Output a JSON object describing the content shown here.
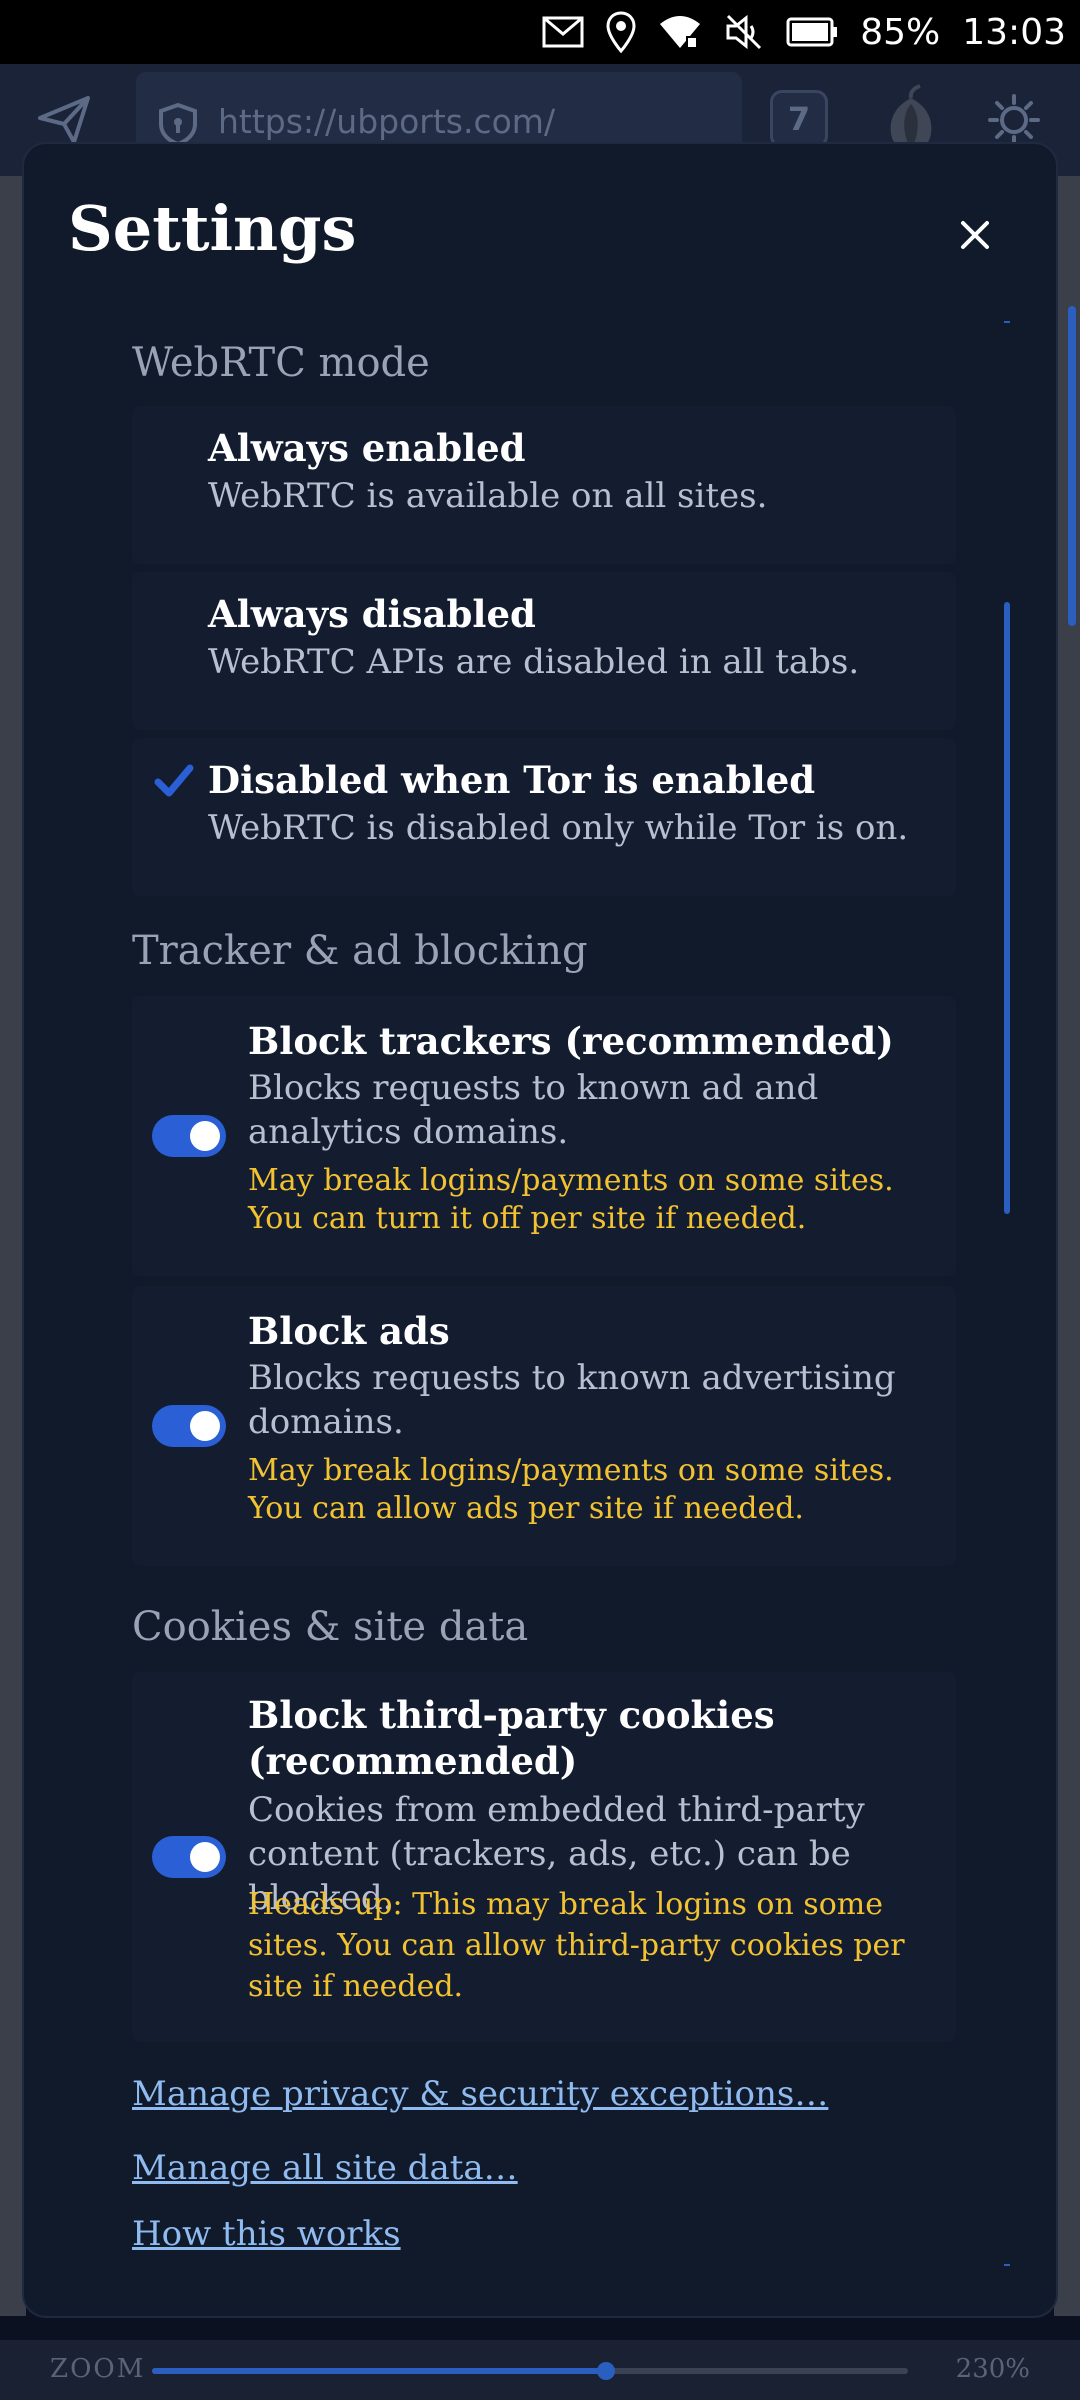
{
  "status_bar": {
    "battery_percent": "85%",
    "time": "13:03"
  },
  "toolbar": {
    "url": "https://ubports.com/",
    "tab_count": "7"
  },
  "zoom": {
    "label": "ZOOM",
    "value": "230%",
    "level": 0.6
  },
  "dialog": {
    "title": "Settings",
    "close_label": "✕"
  },
  "webrtc": {
    "section_title": "WebRTC mode",
    "options": [
      {
        "title": "Always enabled",
        "description": "WebRTC is available on all sites.",
        "selected": false
      },
      {
        "title": "Always disabled",
        "description": "WebRTC APIs are disabled in all tabs.",
        "selected": false
      },
      {
        "title": "Disabled when Tor is enabled",
        "description": "WebRTC is disabled only while Tor is on.",
        "selected": true
      }
    ]
  },
  "tracker": {
    "section_title": "Tracker & ad blocking",
    "items": [
      {
        "title": "Block trackers (recommended)",
        "description": "Blocks requests to known ad and analytics domains.",
        "warning": "May break logins/payments on some sites. You can turn it off per site if needed.",
        "enabled": true
      },
      {
        "title": "Block ads",
        "description": "Blocks requests to known advertising domains.",
        "warning": "May break logins/payments on some sites. You can allow ads per site if needed.",
        "enabled": true
      }
    ]
  },
  "cookies": {
    "section_title": "Cookies & site data",
    "items": [
      {
        "title": "Block third-party cookies (recommended)",
        "description": "Cookies from embedded third-party content (trackers, ads, etc.) can be blocked.",
        "warning": "Heads up: This may break logins on some sites. You can allow third-party cookies per site if needed.",
        "enabled": true
      }
    ]
  },
  "links": {
    "manage_exceptions": "Manage privacy & security exceptions…",
    "manage_site_data": "Manage all site data…",
    "how_this_works": "How this works"
  },
  "colors": {
    "accent": "#2a5fd6",
    "warning": "#f2c230",
    "link": "#8fbbf0",
    "dialog_bg": "#111a2b"
  }
}
